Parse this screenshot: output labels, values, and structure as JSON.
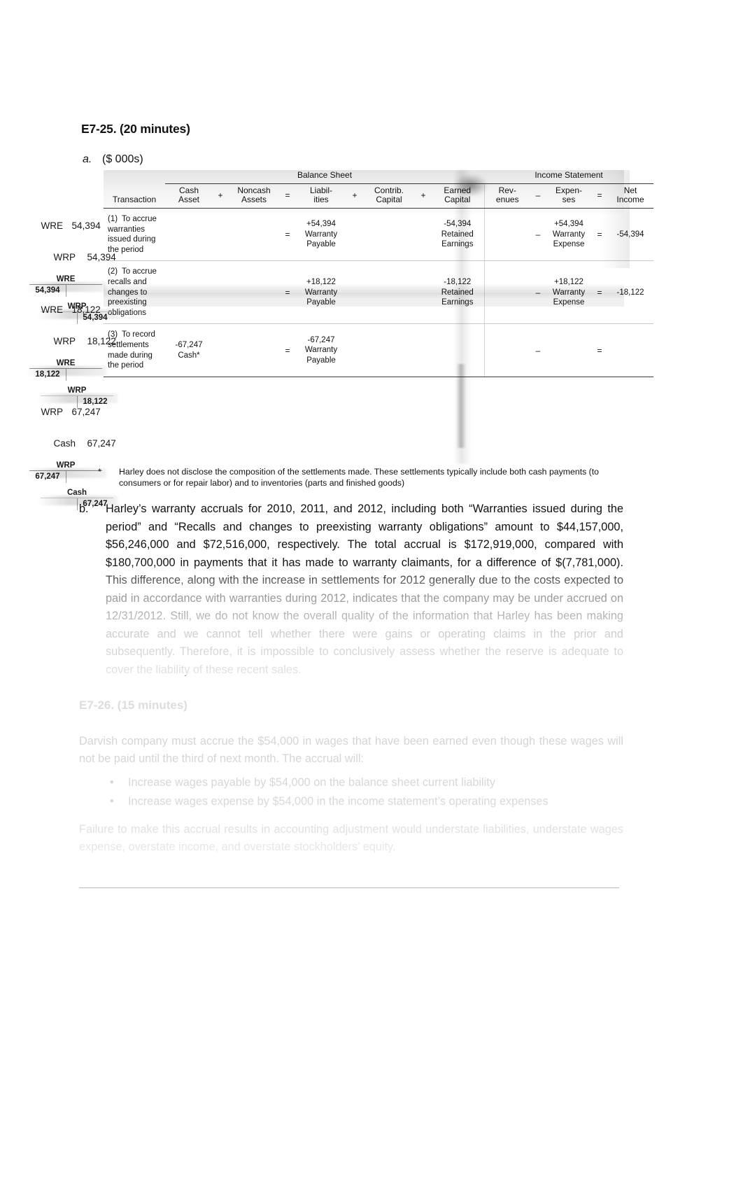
{
  "document": {
    "exercise_title": "E7-25. (20 minutes)",
    "part_a_label": "a.",
    "part_a_units": "($ 000s)"
  },
  "table": {
    "group_headers": {
      "balance_sheet": "Balance Sheet",
      "income_statement": "Income Statement"
    },
    "columns": [
      "Transaction",
      "Cash Asset",
      "Noncash Assets",
      "Liabil- ities",
      "Contrib. Capital",
      "Earned Capital",
      "Rev- enues",
      "Expen- ses",
      "Net Income"
    ],
    "column_parts": {
      "transaction": "Transaction",
      "cash_asset_1": "Cash",
      "cash_asset_2": "Asset",
      "noncash_1": "Noncash",
      "noncash_2": "Assets",
      "liab_1": "Liabil-",
      "liab_2": "ities",
      "contrib_1": "Contrib.",
      "contrib_2": "Capital",
      "earned_1": "Earned",
      "earned_2": "Capital",
      "rev_1": "Rev-",
      "rev_2": "enues",
      "exp_1": "Expen-",
      "exp_2": "ses",
      "ni_1": "Net",
      "ni_2": "Income"
    },
    "operators": {
      "plus": "+",
      "equals": "=",
      "minus": "–"
    },
    "rows": [
      {
        "num": "(1)",
        "description": "To accrue warranties issued during the period",
        "cash_asset": "",
        "noncash_assets": "",
        "op_eq": "=",
        "liabilities": "+54,394 Warranty Payable",
        "contrib_capital": "",
        "earned_capital": "-54,394 Retained Earnings",
        "revenues": "",
        "op_minus": "–",
        "expenses": "+54,394 Warranty Expense",
        "op_eq2": "=",
        "net_income": "-54,394"
      },
      {
        "num": "(2)",
        "description": "To accrue recalls and changes to preexisting obligations",
        "cash_asset": "",
        "noncash_assets": "",
        "op_eq": "=",
        "liabilities": "+18,122 Warranty Payable",
        "contrib_capital": "",
        "earned_capital": "-18,122 Retained Earnings",
        "revenues": "",
        "op_minus": "–",
        "expenses": "+18,122 Warranty Expense",
        "op_eq2": "=",
        "net_income": "-18,122"
      },
      {
        "num": "(3)",
        "description": "To record settlements made during the period",
        "cash_asset": "-67,247 Cash*",
        "noncash_assets": "",
        "op_eq": "=",
        "liabilities": "-67,247 Warranty Payable",
        "contrib_capital": "",
        "earned_capital": "",
        "revenues": "",
        "op_minus": "–",
        "expenses": "",
        "op_eq2": "=",
        "net_income": ""
      }
    ]
  },
  "margin_annotations": [
    {
      "debit_account": "WRE",
      "debit_amount": "54,394",
      "credit_account": "WRP",
      "credit_amount": "54,394",
      "t_accounts": [
        {
          "name": "WRE",
          "debit": "54,394",
          "credit": ""
        },
        {
          "name": "WRP",
          "debit": "",
          "credit": "54,394"
        }
      ]
    },
    {
      "debit_account": "WRE",
      "debit_amount": "18,122",
      "credit_account": "WRP",
      "credit_amount": "18,122",
      "t_accounts": [
        {
          "name": "WRE",
          "debit": "18,122",
          "credit": ""
        },
        {
          "name": "WRP",
          "debit": "",
          "credit": "18,122"
        }
      ]
    },
    {
      "debit_account": "WRP",
      "debit_amount": "67,247",
      "credit_account": "Cash",
      "credit_amount": "67,247",
      "t_accounts": [
        {
          "name": "WRP",
          "debit": "67,247",
          "credit": ""
        },
        {
          "name": "Cash",
          "debit": "",
          "credit": "67,247"
        }
      ]
    }
  ],
  "footnote": {
    "marker": "*",
    "text": "Harley does not disclose the composition of the settlements made. These settlements typically include both cash payments (to consumers or for repair labor) and to inventories (parts and finished goods)"
  },
  "part_b": {
    "label": "b.",
    "text": "Harley’s warranty accruals for 2010, 2011, and 2012, including both “Warranties issued during the period” and “Recalls and changes to preexisting warranty obligations” amount to $44,157,000, $56,246,000 and $72,516,000, respectively. The total accrual is $172,919,000, compared with $180,700,000 in payments that it has made to warranty claimants, for a difference of $(7,781,000). This difference, along with the increase in settlements for 2012 generally due to the costs expected to paid in accordance with warranties during 2012, indicates that the company may be under accrued on 12/31/2012. Still, we do not know the overall quality of the information that Harley has been making accurate and we cannot tell whether there were gains or operating claims in the prior and subsequently. Therefore, it is impossible to conclusively assess whether the reserve is adequate to cover the liability of these recent sales."
  },
  "section_c": {
    "title": "E7-26. (15 minutes)",
    "paragraph_1": "Darvish company must accrue the $54,000 in wages that have been earned even though these wages will not be paid until the third of next month. The accrual will:",
    "bullets": [
      "Increase wages payable by $54,000 on the balance sheet current liability",
      "Increase wages expense by $54,000 in the income statement’s operating expenses"
    ],
    "paragraph_2": "Failure to make this accrual results in accounting adjustment would understate liabilities, understate wages expense, overstate income, and overstate stockholders’ equity."
  }
}
